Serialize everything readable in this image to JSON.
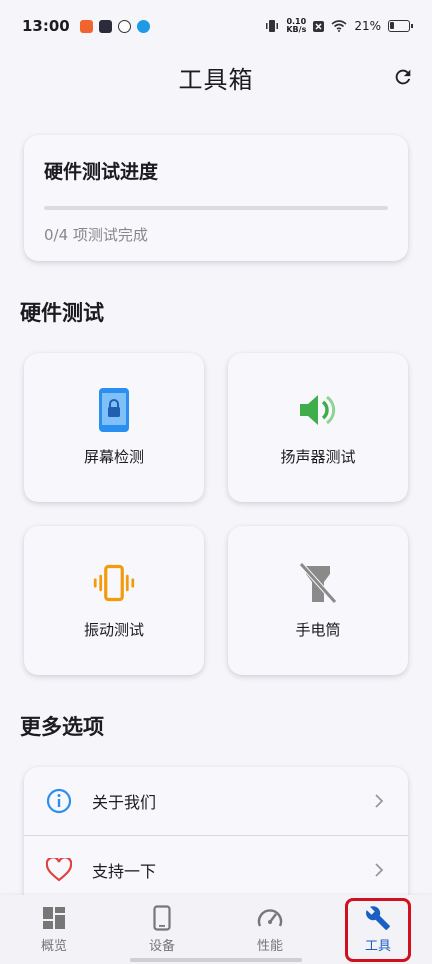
{
  "status_bar": {
    "time": "13:00",
    "net_speed_top": "0.10",
    "net_speed_bottom": "KB/s",
    "battery": "21%"
  },
  "header": {
    "title": "工具箱"
  },
  "progress": {
    "title": "硬件测试进度",
    "status": "0/4 项测试完成",
    "fraction": 0
  },
  "hardware_section": {
    "title": "硬件测试",
    "tiles": [
      {
        "label": "屏幕检测",
        "icon": "phone-lock-icon",
        "color": "#2a8ff0"
      },
      {
        "label": "扬声器测试",
        "icon": "speaker-icon",
        "color": "#3fae4a"
      },
      {
        "label": "振动测试",
        "icon": "vibration-icon",
        "color": "#f29b0c"
      },
      {
        "label": "手电筒",
        "icon": "flashlight-off-icon",
        "color": "#8a8a8a"
      }
    ]
  },
  "more_section": {
    "title": "更多选项",
    "items": [
      {
        "label": "关于我们",
        "icon": "info-icon",
        "color": "#2a8ff0"
      },
      {
        "label": "支持一下",
        "icon": "heart-icon",
        "color": "#e04040"
      }
    ]
  },
  "bottom_nav": {
    "items": [
      {
        "label": "概览",
        "icon": "dashboard-icon"
      },
      {
        "label": "设备",
        "icon": "device-icon"
      },
      {
        "label": "性能",
        "icon": "speedometer-icon"
      },
      {
        "label": "工具",
        "icon": "wrench-icon"
      }
    ],
    "active": "工具"
  }
}
